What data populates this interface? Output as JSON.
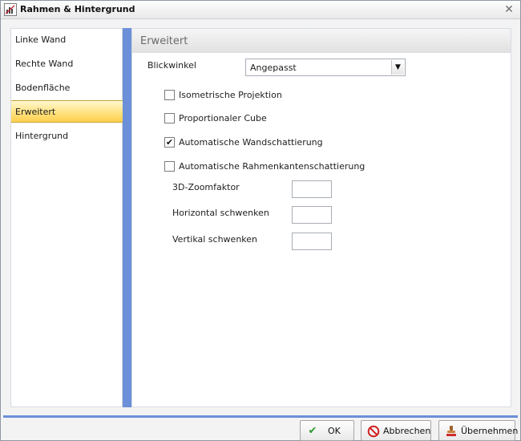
{
  "window": {
    "title": "Rahmen & Hintergrund"
  },
  "sidebar": {
    "items": [
      {
        "label": "Linke Wand"
      },
      {
        "label": "Rechte Wand"
      },
      {
        "label": "Bodenfläche"
      },
      {
        "label": "Erweitert",
        "active": true
      },
      {
        "label": "Hintergrund"
      }
    ]
  },
  "content": {
    "title": "Erweitert",
    "viewing_angle": {
      "label": "Blickwinkel",
      "value": "Angepasst"
    },
    "checkboxes": [
      {
        "label": "Isometrische Projektion",
        "checked": false
      },
      {
        "label": "Proportionaler Cube",
        "checked": false
      },
      {
        "label": "Automatische Wandschattierung",
        "checked": true
      },
      {
        "label": "Automatische Rahmenkantenschattierung",
        "checked": false
      }
    ],
    "numeric_fields": [
      {
        "label": "3D-Zoomfaktor",
        "value": ""
      },
      {
        "label": "Horizontal schwenken",
        "value": ""
      },
      {
        "label": "Vertikal schwenken",
        "value": ""
      }
    ]
  },
  "footer": {
    "ok_label": "OK",
    "cancel_label": "Abbrechen",
    "apply_label": "Übernehmen"
  },
  "colors": {
    "accent": "#6b8fd8",
    "active_item": "#ffe07a"
  }
}
